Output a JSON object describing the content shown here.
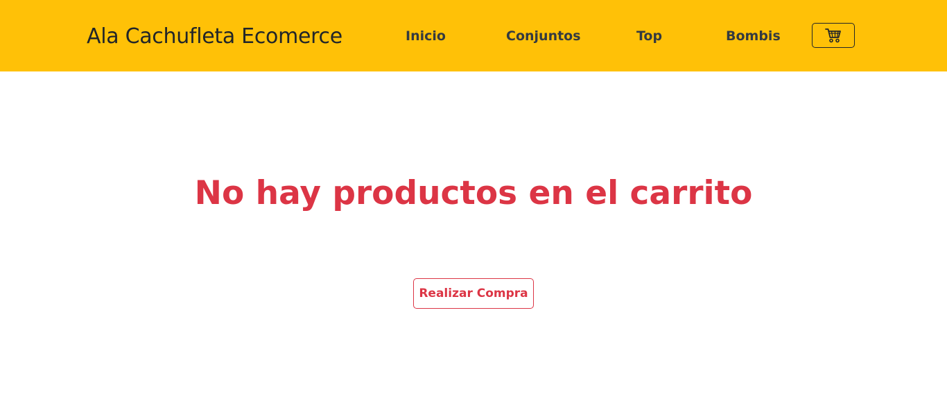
{
  "brand": {
    "name": "Ala Cachufleta Ecomerce"
  },
  "nav": {
    "items": [
      {
        "label": "Inicio"
      },
      {
        "label": "Conjuntos"
      },
      {
        "label": "Top"
      },
      {
        "label": "Bombis"
      }
    ],
    "cart_icon": "shopping-cart-icon"
  },
  "main": {
    "empty_message": "No hay productos en el carrito",
    "checkout_label": "Realizar Compra"
  },
  "colors": {
    "navbar": "#ffc107",
    "accent": "#dc3545",
    "text": "#212529"
  }
}
